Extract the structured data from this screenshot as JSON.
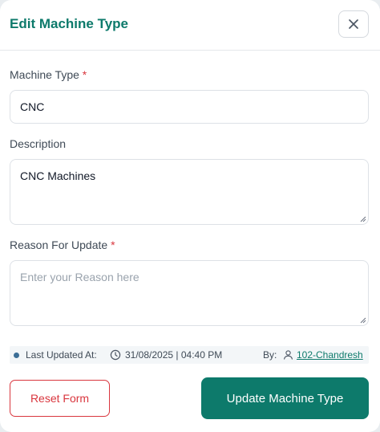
{
  "modal": {
    "title": "Edit Machine Type"
  },
  "form": {
    "machine_type": {
      "label": "Machine Type",
      "required_mark": "*",
      "value": "CNC"
    },
    "description": {
      "label": "Description",
      "value": "CNC Machines"
    },
    "reason": {
      "label": "Reason For Update",
      "required_mark": "*",
      "placeholder": "Enter your Reason here",
      "value": ""
    }
  },
  "meta": {
    "last_updated_label": "Last Updated At:",
    "datetime": "31/08/2025 | 04:40 PM",
    "by_label": "By:",
    "user": "102-Chandresh"
  },
  "actions": {
    "reset_label": "Reset Form",
    "update_label": "Update Machine Type"
  },
  "colors": {
    "accent": "#0d7a6b",
    "danger": "#d9363e"
  },
  "icons": {
    "close": "close-icon",
    "clock": "clock-icon",
    "user": "user-icon"
  }
}
